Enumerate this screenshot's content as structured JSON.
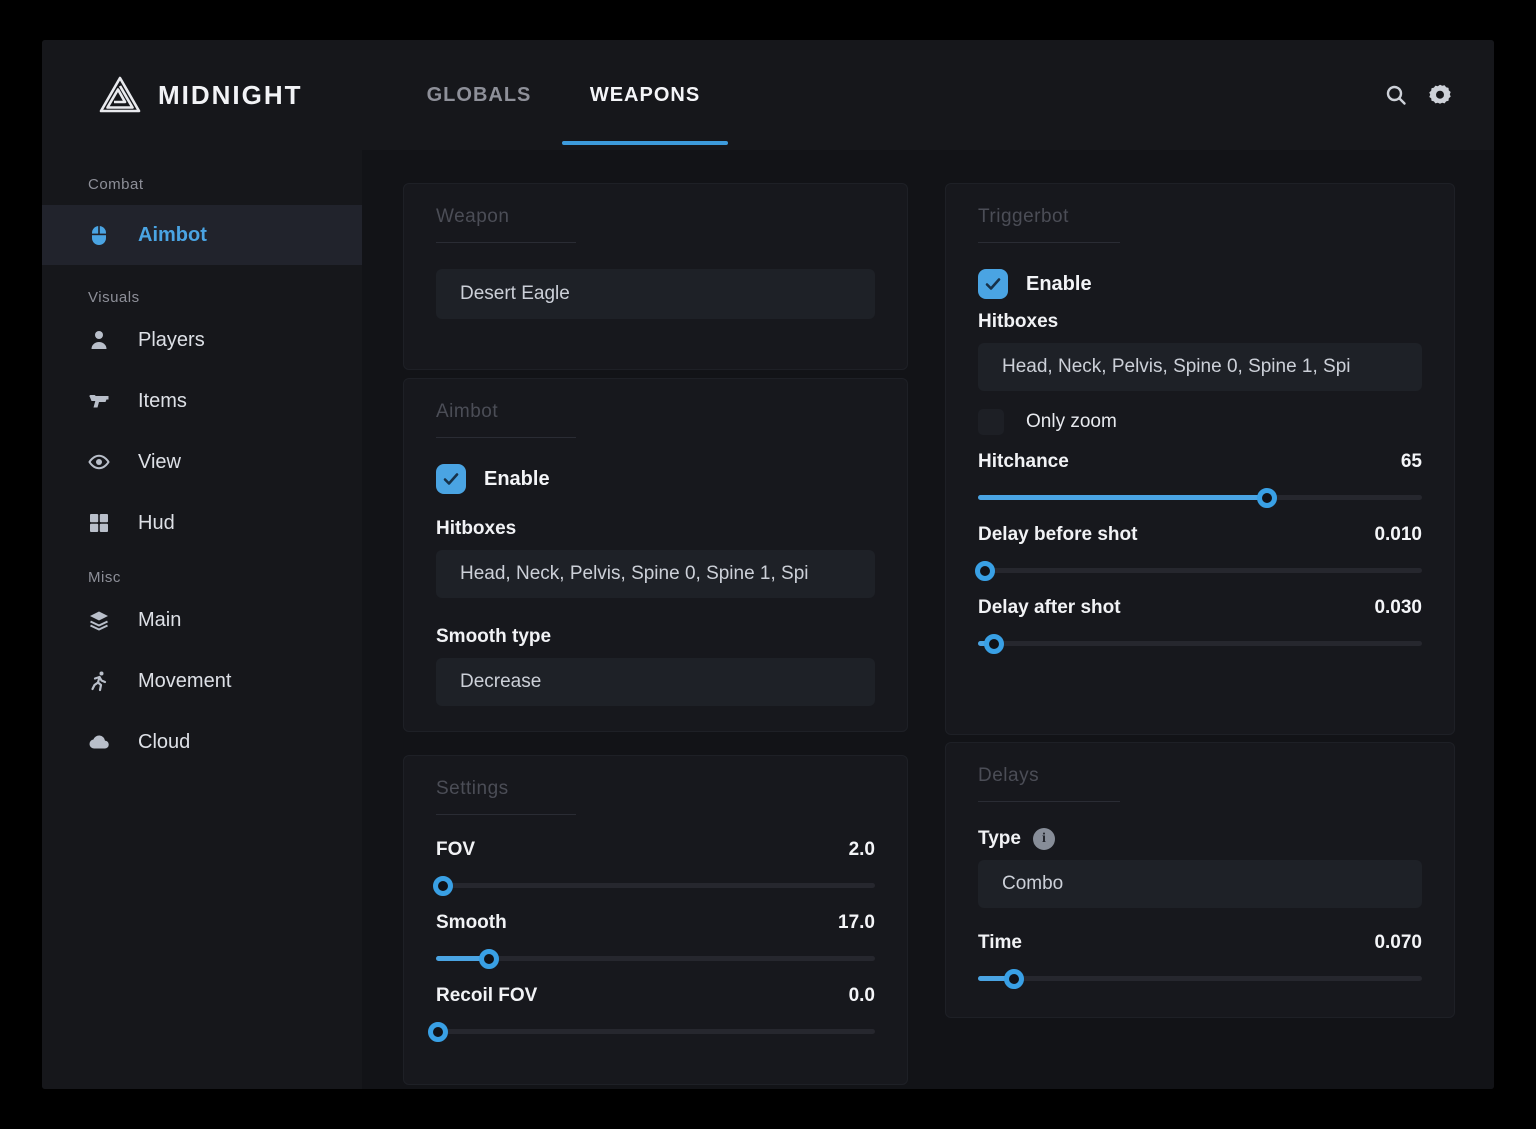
{
  "app": {
    "title": "MIDNIGHT"
  },
  "colors": {
    "accent": "#4aa4e3",
    "window_bg": "#15161a",
    "card_bg": "#17181d",
    "text": "#f1f2f5",
    "dim_title": "#4b4d56"
  },
  "header": {
    "tabs": [
      {
        "label": "GLOBALS",
        "active": false
      },
      {
        "label": "WEAPONS",
        "active": true
      }
    ],
    "icons": [
      "search-icon",
      "settings-gear-icon"
    ]
  },
  "sidebar": {
    "sections": [
      {
        "label": "Combat",
        "items": [
          {
            "label": "Aimbot",
            "icon": "mouse-icon",
            "active": true
          }
        ]
      },
      {
        "label": "Visuals",
        "items": [
          {
            "label": "Players",
            "icon": "person-icon",
            "active": false
          },
          {
            "label": "Items",
            "icon": "pistol-icon",
            "active": false
          },
          {
            "label": "View",
            "icon": "eye-icon",
            "active": false
          },
          {
            "label": "Hud",
            "icon": "grid-icon",
            "active": false
          }
        ]
      },
      {
        "label": "Misc",
        "items": [
          {
            "label": "Main",
            "icon": "layers-icon",
            "active": false
          },
          {
            "label": "Movement",
            "icon": "runner-icon",
            "active": false
          },
          {
            "label": "Cloud",
            "icon": "cloud-icon",
            "active": false
          }
        ]
      }
    ]
  },
  "panels": {
    "weapon": {
      "title": "Weapon",
      "select_value": "Desert Eagle"
    },
    "aimbot": {
      "title": "Aimbot",
      "enable_label": "Enable",
      "enabled": true,
      "hitboxes_label": "Hitboxes",
      "hitboxes_value": "Head, Neck, Pelvis, Spine 0, Spine 1, Spi",
      "smooth_type_label": "Smooth type",
      "smooth_type_value": "Decrease"
    },
    "settings": {
      "title": "Settings",
      "sliders": [
        {
          "label": "FOV",
          "value": "2.0",
          "percent": 1.5
        },
        {
          "label": "Smooth",
          "value": "17.0",
          "percent": 12
        },
        {
          "label": "Recoil FOV",
          "value": "0.0",
          "percent": 0.5
        }
      ]
    },
    "triggerbot": {
      "title": "Triggerbot",
      "enable_label": "Enable",
      "enabled": true,
      "hitboxes_label": "Hitboxes",
      "hitboxes_value": "Head, Neck, Pelvis, Spine 0, Spine 1, Spi",
      "only_zoom_label": "Only zoom",
      "only_zoom_checked": false,
      "sliders": [
        {
          "label": "Hitchance",
          "value": "65",
          "percent": 65
        },
        {
          "label": "Delay before shot",
          "value": "0.010",
          "percent": 1.5
        },
        {
          "label": "Delay after shot",
          "value": "0.030",
          "percent": 3.5
        }
      ]
    },
    "delays": {
      "title": "Delays",
      "type_label": "Type",
      "type_value": "Combo",
      "sliders": [
        {
          "label": "Time",
          "value": "0.070",
          "percent": 8
        }
      ]
    }
  }
}
